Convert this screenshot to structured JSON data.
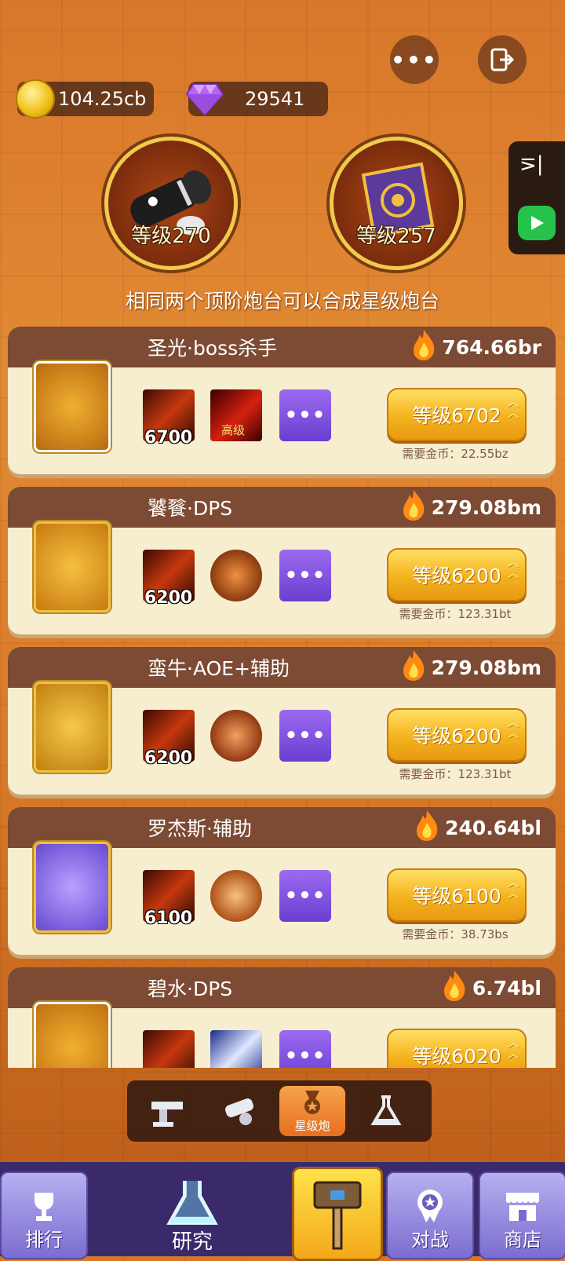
{
  "top_bar": {
    "more_label": "•••",
    "coins": "104.25cb",
    "gems": "29541"
  },
  "main_turrets": [
    {
      "name": "cannon",
      "level": "等级270"
    },
    {
      "name": "book",
      "level": "等级257"
    }
  ],
  "info_text": "相同两个顶阶炮台可以合成星级炮台",
  "cards": [
    {
      "title": "圣光·boss杀手",
      "power": "764.66br",
      "skill1_level": "6700",
      "skill2_label": "高级",
      "more": "•••",
      "upgrade": "等级6702",
      "cost": "需要金币：22.55bz"
    },
    {
      "title": "饕餮·DPS",
      "power": "279.08bm",
      "skill1_level": "6200",
      "skill2_label": "",
      "more": "•••",
      "upgrade": "等级6200",
      "cost": "需要金币：123.31bt"
    },
    {
      "title": "蛮牛·AOE+辅助",
      "power": "279.08bm",
      "skill1_level": "6200",
      "skill2_label": "",
      "more": "•••",
      "upgrade": "等级6200",
      "cost": "需要金币：123.31bt"
    },
    {
      "title": "罗杰斯·辅助",
      "power": "240.64bl",
      "skill1_level": "6100",
      "skill2_label": "",
      "more": "•••",
      "upgrade": "等级6100",
      "cost": "需要金币：38.73bs"
    },
    {
      "title": "碧水·DPS",
      "power": "6.74bl",
      "skill1_level": "",
      "skill2_label": "",
      "more": "•••",
      "upgrade": "等级6020",
      "cost": ""
    }
  ],
  "sub_tabs": {
    "active_label": "星级炮"
  },
  "bottom_nav": {
    "rank": "排行",
    "research": "研究",
    "battle": "对战",
    "shop": "商店"
  },
  "colors": {
    "card_header": "#7d4a34",
    "card_body": "#f7edcf",
    "upgrade_button": "#f4b21c",
    "nav_bar": "#3b2a6b"
  },
  "icons": {
    "more": "more-dots-icon",
    "exit": "exit-icon",
    "coin": "gold-coin-icon",
    "gem": "purple-gem-icon",
    "flame": "flame-icon"
  }
}
